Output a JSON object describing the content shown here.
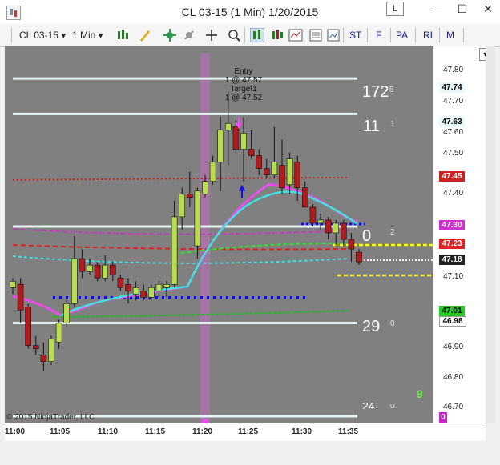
{
  "window": {
    "title": "CL 03-15 (1 Min)  1/20/2015",
    "link_button": "L",
    "minimize": "—",
    "maximize": "☐",
    "close": "✕"
  },
  "toolbar": {
    "instrument": "CL 03-15",
    "interval": "1 Min",
    "buttons": [
      "ST",
      "F",
      "PA",
      "RI",
      "M"
    ],
    "icons": [
      "chart-style-icon",
      "draw-icon",
      "insert-icon",
      "remove-icon",
      "crosshair-icon",
      "zoom-icon",
      "bar-type-icon",
      "candle-icon",
      "properties-icon",
      "data-box-icon",
      "indicators-icon"
    ]
  },
  "chart": {
    "copyright": "© 2015 NinjaTrader, LLC",
    "price_axis": [
      "47.80",
      "47.70",
      "47.60",
      "47.50",
      "47.40",
      "47.20",
      "47.10",
      "46.90",
      "46.80",
      "46.70"
    ],
    "price_boxes": [
      {
        "label": "47.74",
        "bg": "#e8f8f8",
        "fg": "#000000"
      },
      {
        "label": "47.63",
        "bg": "#e8f8f8",
        "fg": "#000000"
      },
      {
        "label": "47.45",
        "bg": "#cc2222",
        "fg": "#ffffff"
      },
      {
        "label": "47.30",
        "bg": "#cc33cc",
        "fg": "#ffffff"
      },
      {
        "label": "47.23",
        "bg": "#dd2222",
        "fg": "#ffffff"
      },
      {
        "label": "47.18",
        "bg": "#222222",
        "fg": "#ffffff"
      },
      {
        "label": "47.01",
        "bg": "#22cc22",
        "fg": "#000000"
      },
      {
        "label": "46.98",
        "bg": "#ffffff",
        "fg": "#000000"
      },
      {
        "label": "0",
        "bg": "#cc22cc",
        "fg": "#ffffff"
      }
    ],
    "time_axis": [
      "11:00",
      "11:05",
      "11:10",
      "11:15",
      "11:20",
      "11:25",
      "11:30",
      "11:35"
    ],
    "level_labels": [
      {
        "big": "172",
        "small": "5"
      },
      {
        "big": "11",
        "small": "1"
      },
      {
        "big": "0",
        "small": "2"
      },
      {
        "big": "29",
        "small": "0"
      },
      {
        "big": "24",
        "small": "0"
      }
    ],
    "count_label": "9",
    "annotation": {
      "line1": "Entry",
      "line2": "1 @ 47.57",
      "line3": "Target1",
      "line4": "1 @ 47.52"
    }
  },
  "chart_data": {
    "type": "candlestick",
    "title": "CL 03-15 (1 Min)  1/20/2015",
    "x_labels": [
      "11:00",
      "11:05",
      "11:10",
      "11:15",
      "11:20",
      "11:25",
      "11:30",
      "11:35"
    ],
    "ylim": [
      46.67,
      47.84
    ],
    "candles": [
      {
        "o": 47.09,
        "h": 47.12,
        "l": 47.07,
        "c": 47.11
      },
      {
        "o": 47.1,
        "h": 47.12,
        "l": 46.98,
        "c": 47.02
      },
      {
        "o": 47.03,
        "h": 47.04,
        "l": 46.9,
        "c": 46.91
      },
      {
        "o": 46.91,
        "h": 46.94,
        "l": 46.88,
        "c": 46.9
      },
      {
        "o": 46.88,
        "h": 46.92,
        "l": 46.83,
        "c": 46.86
      },
      {
        "o": 46.86,
        "h": 46.94,
        "l": 46.85,
        "c": 46.93
      },
      {
        "o": 46.92,
        "h": 46.99,
        "l": 46.9,
        "c": 46.98
      },
      {
        "o": 46.98,
        "h": 47.05,
        "l": 46.97,
        "c": 47.04
      },
      {
        "o": 47.04,
        "h": 47.25,
        "l": 47.03,
        "c": 47.18
      },
      {
        "o": 47.18,
        "h": 47.21,
        "l": 47.12,
        "c": 47.14
      },
      {
        "o": 47.14,
        "h": 47.18,
        "l": 47.13,
        "c": 47.16
      },
      {
        "o": 47.16,
        "h": 47.17,
        "l": 47.11,
        "c": 47.12
      },
      {
        "o": 47.12,
        "h": 47.19,
        "l": 47.11,
        "c": 47.16
      },
      {
        "o": 47.16,
        "h": 47.17,
        "l": 47.11,
        "c": 47.13
      },
      {
        "o": 47.12,
        "h": 47.13,
        "l": 47.08,
        "c": 47.09
      },
      {
        "o": 47.1,
        "h": 47.12,
        "l": 47.04,
        "c": 47.08
      },
      {
        "o": 47.07,
        "h": 47.11,
        "l": 47.05,
        "c": 47.09
      },
      {
        "o": 47.08,
        "h": 47.1,
        "l": 47.05,
        "c": 47.06
      },
      {
        "o": 47.06,
        "h": 47.1,
        "l": 47.05,
        "c": 47.09
      },
      {
        "o": 47.08,
        "h": 47.11,
        "l": 47.06,
        "c": 47.1
      },
      {
        "o": 47.09,
        "h": 47.11,
        "l": 47.06,
        "c": 47.1
      },
      {
        "o": 47.1,
        "h": 47.36,
        "l": 47.09,
        "c": 47.31
      },
      {
        "o": 47.31,
        "h": 47.4,
        "l": 47.27,
        "c": 47.38
      },
      {
        "o": 47.38,
        "h": 47.45,
        "l": 47.34,
        "c": 47.37
      },
      {
        "o": 47.22,
        "h": 47.4,
        "l": 47.18,
        "c": 47.39
      },
      {
        "o": 47.38,
        "h": 47.44,
        "l": 47.37,
        "c": 47.42
      },
      {
        "o": 47.42,
        "h": 47.5,
        "l": 47.41,
        "c": 47.48
      },
      {
        "o": 47.48,
        "h": 47.62,
        "l": 47.39,
        "c": 47.58
      },
      {
        "o": 47.58,
        "h": 47.7,
        "l": 47.47,
        "c": 47.6
      },
      {
        "o": 47.59,
        "h": 47.61,
        "l": 47.51,
        "c": 47.52
      },
      {
        "o": 47.52,
        "h": 47.62,
        "l": 47.42,
        "c": 47.57
      },
      {
        "o": 47.52,
        "h": 47.58,
        "l": 47.49,
        "c": 47.5
      },
      {
        "o": 47.5,
        "h": 47.52,
        "l": 47.44,
        "c": 47.46
      },
      {
        "o": 47.46,
        "h": 47.49,
        "l": 47.43,
        "c": 47.44
      },
      {
        "o": 47.44,
        "h": 47.59,
        "l": 47.43,
        "c": 47.48
      },
      {
        "o": 47.47,
        "h": 47.55,
        "l": 47.38,
        "c": 47.4
      },
      {
        "o": 47.41,
        "h": 47.51,
        "l": 47.38,
        "c": 47.49
      },
      {
        "o": 47.48,
        "h": 47.5,
        "l": 47.36,
        "c": 47.4
      },
      {
        "o": 47.4,
        "h": 47.42,
        "l": 47.34,
        "c": 47.34
      },
      {
        "o": 47.34,
        "h": 47.35,
        "l": 47.28,
        "c": 47.29
      },
      {
        "o": 47.29,
        "h": 47.32,
        "l": 47.27,
        "c": 47.3
      },
      {
        "o": 47.3,
        "h": 47.31,
        "l": 47.24,
        "c": 47.26
      },
      {
        "o": 47.26,
        "h": 47.3,
        "l": 47.22,
        "c": 47.29
      },
      {
        "o": 47.29,
        "h": 47.3,
        "l": 47.22,
        "c": 47.24
      },
      {
        "o": 47.24,
        "h": 47.26,
        "l": 47.17,
        "c": 47.21
      },
      {
        "o": 47.2,
        "h": 47.21,
        "l": 47.16,
        "c": 47.17
      }
    ],
    "horizontal_levels": [
      47.74,
      47.63,
      47.28,
      46.98,
      46.69
    ],
    "colors": {
      "up": "#b8dc50",
      "down": "#b01c1c",
      "background": "#808080"
    }
  }
}
